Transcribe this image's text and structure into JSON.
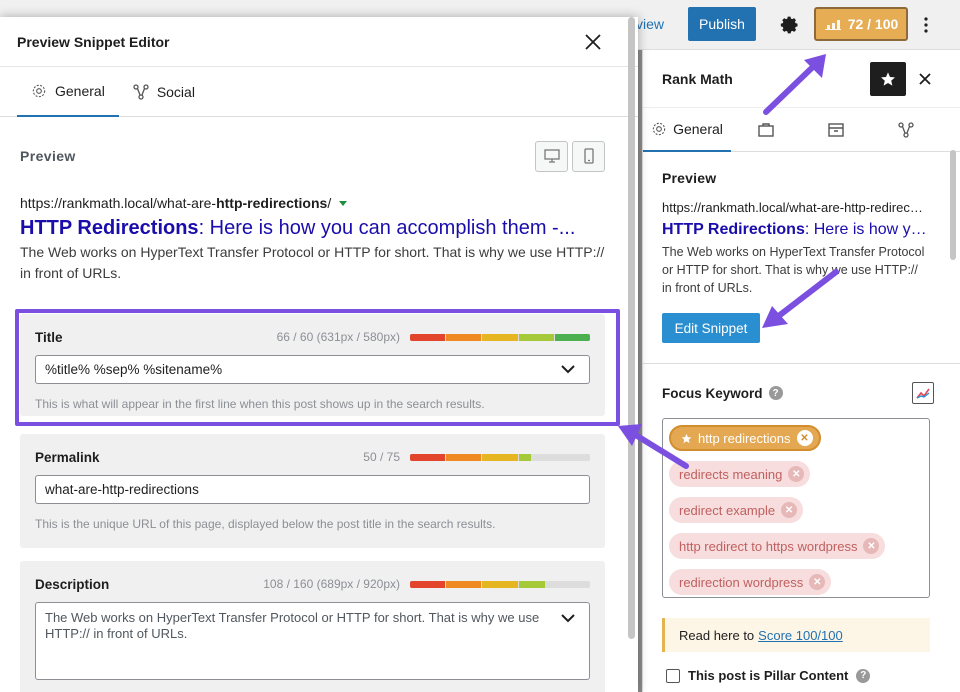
{
  "topbar": {
    "preview_label": "view",
    "publish_label": "Publish",
    "score_label": "72 / 100",
    "colors": {
      "publish": "#2271b1",
      "score_bg": "#e6ad55"
    }
  },
  "sidebar": {
    "title": "Rank Math",
    "tabs": [
      {
        "label": "General",
        "icon": "gear-icon"
      },
      {
        "icon": "briefcase-icon"
      },
      {
        "icon": "schema-icon"
      },
      {
        "icon": "social-share-icon"
      }
    ],
    "preview": {
      "heading": "Preview",
      "url": "https://rankmath.local/what-are-http-redirections/",
      "title_bold": "HTTP Redirections",
      "title_rest": ": Here is how you can accomplish them -...",
      "description": "The Web works on HyperText Transfer Protocol or HTTP for short. That is why we use HTTP:// in front of URLs.",
      "edit_label": "Edit Snippet"
    },
    "focus_keyword": {
      "label": "Focus Keyword",
      "primary": "http redirections",
      "secondary": [
        "redirects meaning",
        "redirect example",
        "http redirect to https wordpress",
        "redirection wordpress"
      ]
    },
    "notice": {
      "text": "Read here to",
      "link": "Score 100/100"
    },
    "pillar_label": "This post is Pillar Content"
  },
  "modal": {
    "title": "Preview Snippet Editor",
    "tabs": [
      {
        "label": "General",
        "icon": "gear-icon"
      },
      {
        "label": "Social",
        "icon": "social-share-icon"
      }
    ],
    "preview_label": "Preview",
    "url_prefix": "https://rankmath.local/what-are-",
    "url_bold": "http-redirections",
    "url_suffix": "/",
    "serp_title_bold": "HTTP Redirections",
    "serp_title_rest": ": Here is how you can accomplish them -...",
    "serp_desc": "The Web works on HyperText Transfer Protocol or HTTP for short. That is why we use HTTP:// in front of URLs.",
    "fields": {
      "title": {
        "label": "Title",
        "meta": "66 / 60 (631px / 580px)",
        "value": "%title% %sep% %sitename%",
        "help": "This is what will appear in the first line when this post shows up in the search results.",
        "meter_fill": 1.0
      },
      "permalink": {
        "label": "Permalink",
        "meta": "50 / 75",
        "value": "what-are-http-redirections",
        "help": "This is the unique URL of this page, displayed below the post title in the search results.",
        "meter_fill": 0.67
      },
      "description": {
        "label": "Description",
        "meta": "108 / 160 (689px / 920px)",
        "value": "The Web works on HyperText Transfer Protocol or HTTP for short. That is why we use HTTP:// in front of URLs.",
        "meter_fill": 0.75
      }
    }
  },
  "colors": {
    "accent_purple": "#7b4fe0",
    "link_blue": "#1a0dab"
  }
}
